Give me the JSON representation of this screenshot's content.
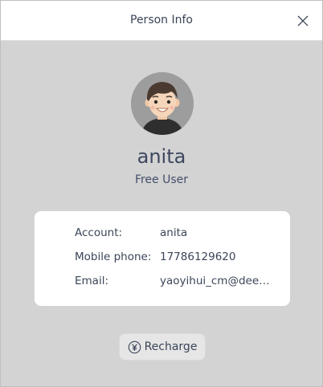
{
  "window": {
    "title": "Person Info"
  },
  "profile": {
    "username": "anita",
    "user_type": "Free User"
  },
  "info": {
    "rows": [
      {
        "label": "Account:",
        "value": "anita"
      },
      {
        "label": "Mobile phone:",
        "value": "17786129620"
      },
      {
        "label": "Email:",
        "value": "yaoyihui_cm@deep..."
      }
    ]
  },
  "actions": {
    "recharge_label": "Recharge"
  },
  "icons": {
    "close": "close-icon",
    "avatar": "avatar",
    "recharge": "yuan-coin-icon"
  },
  "colors": {
    "background": "#d3d3d3",
    "titlebar": "#ffffff",
    "card": "#ffffff",
    "text": "#414d68"
  }
}
